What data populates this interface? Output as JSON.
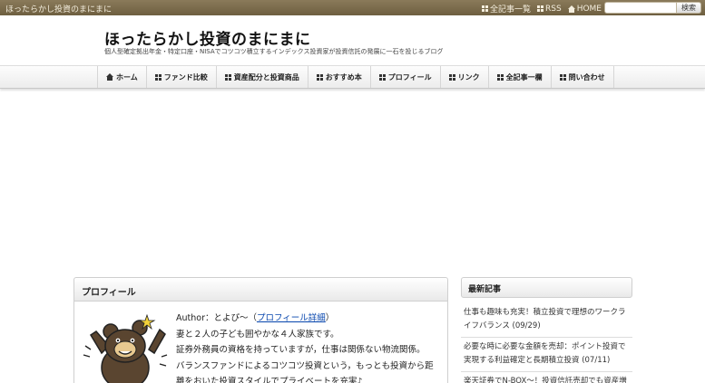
{
  "topbar": {
    "site_small": "ほったらかし投資のまにまに",
    "links": [
      "全記事一覧",
      "RSS",
      "HOME"
    ],
    "search_placeholder": "",
    "search_button": "検索"
  },
  "header": {
    "title": "ほったらかし投資のまにまに",
    "description": "個人型確定拠出年金・特定口座・NISAでコツコツ積立するインデックス投資家が投資信託の発展に一石を投じるブログ"
  },
  "nav": {
    "items": [
      "ホーム",
      "ファンド比較",
      "資産配分と投資商品",
      "おすすめ本",
      "プロフィール",
      "リンク",
      "全記事一欄",
      "問い合わせ"
    ]
  },
  "profile": {
    "heading": "プロフィール",
    "author_prefix": "Author：とよぴ～（",
    "author_link": "プロフィール詳細",
    "author_suffix": "）",
    "lines": [
      "妻と２人の子ども囲やかな４人家族です。",
      "証券外務員の資格を持っていますが，仕事は関係ない物流関係。",
      "バランスファンドによるコツコツ投資という，もっとも投資から距",
      "離をおいた投資スタイルでプライベートを充実♪"
    ]
  },
  "sidebar": {
    "heading": "最新記事",
    "items": [
      "仕事も趣味も充実！積立投資で理想のワークライフバランス (09/29)",
      "必要な時に必要な金額を売却：ポイント投資で実現する利益確定と長期積立投資 (07/11)",
      "楽天証券でN-BOX～！投資信託売却でも資産増"
    ]
  },
  "colors": {
    "topbar": "#7a6a4a",
    "link": "#0645ad"
  }
}
